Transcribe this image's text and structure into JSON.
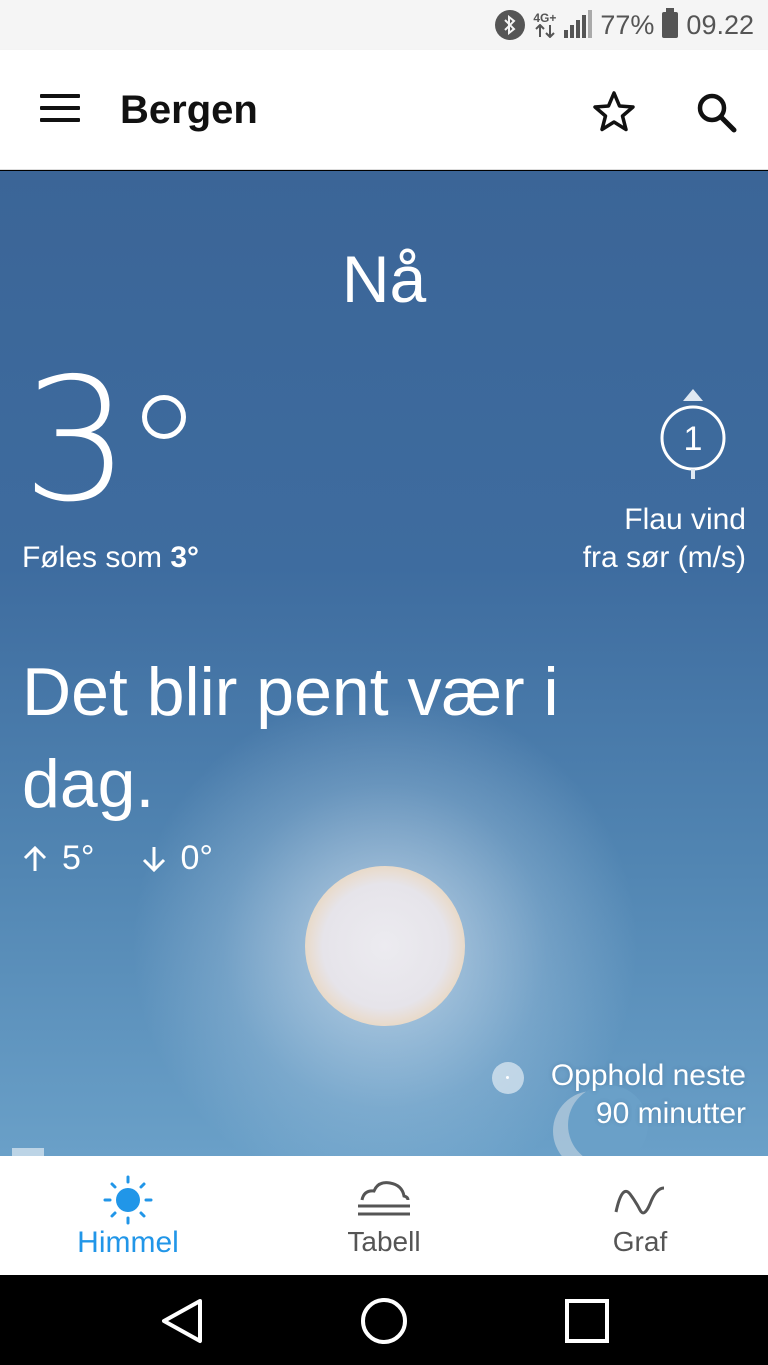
{
  "status_bar": {
    "network_type": "4G+",
    "battery": "77%",
    "time": "09.22",
    "icons": [
      "bluetooth-icon",
      "data-arrows-icon",
      "signal-icon",
      "battery-icon"
    ]
  },
  "app_bar": {
    "title": "Bergen",
    "icons": [
      "menu-icon",
      "star-icon",
      "search-icon"
    ]
  },
  "weather": {
    "period_label": "Nå",
    "temperature": "3",
    "feels_like_prefix": "Føles som",
    "feels_like_value": "3°",
    "wind_speed": "1",
    "wind_line1": "Flau vind",
    "wind_line2": "fra sør (m/s)",
    "summary": "Det blir pent vær i dag.",
    "high": "5°",
    "low": "0°",
    "precip_line1": "Opphold neste",
    "precip_line2": "90 minutter"
  },
  "tabs": [
    {
      "label": "Himmel",
      "icon": "sun-icon",
      "active": true
    },
    {
      "label": "Tabell",
      "icon": "cloud-lines-icon",
      "active": false
    },
    {
      "label": "Graf",
      "icon": "wave-graph-icon",
      "active": false
    }
  ],
  "colors": {
    "accent": "#2196e8",
    "sky_top": "#3b6597",
    "sky_bottom": "#6aa0c8"
  }
}
